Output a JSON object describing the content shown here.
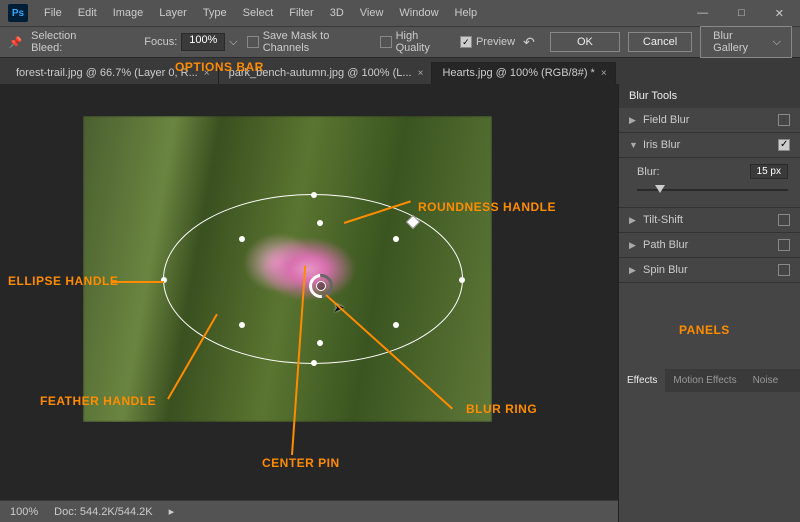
{
  "menubar": {
    "items": [
      "File",
      "Edit",
      "Image",
      "Layer",
      "Type",
      "Select",
      "Filter",
      "3D",
      "View",
      "Window",
      "Help"
    ]
  },
  "optbar": {
    "selection_bleed": "Selection Bleed:",
    "focus_label": "Focus:",
    "focus_value": "100%",
    "save_mask": "Save Mask to Channels",
    "high_quality": "High Quality",
    "preview": "Preview",
    "ok": "OK",
    "cancel": "Cancel",
    "blur_gallery": "Blur Gallery"
  },
  "tabs": [
    {
      "label": "forest-trail.jpg @ 66.7% (Layer 0, R..."
    },
    {
      "label": "park_bench-autumn.jpg @ 100% (L..."
    },
    {
      "label": "Hearts.jpg @ 100% (RGB/8#) *"
    }
  ],
  "panels": {
    "title": "Blur Tools",
    "field_blur": "Field Blur",
    "iris_blur": "Iris Blur",
    "blur_label": "Blur:",
    "blur_value": "15 px",
    "tilt_shift": "Tilt-Shift",
    "path_blur": "Path Blur",
    "spin_blur": "Spin Blur",
    "effects": "Effects",
    "motion": "Motion Effects",
    "noise": "Noise"
  },
  "annotations": {
    "options_bar": "OPTIONS BAR",
    "roundness": "ROUNDNESS HANDLE",
    "ellipse": "ELLIPSE HANDLE",
    "feather": "FEATHER HANDLE",
    "blur_ring": "BLUR RING",
    "center_pin": "CENTER PIN",
    "panels": "PANELS"
  },
  "status": {
    "zoom": "100%",
    "doc_label": "Doc:",
    "doc": "544.2K/544.2K"
  }
}
